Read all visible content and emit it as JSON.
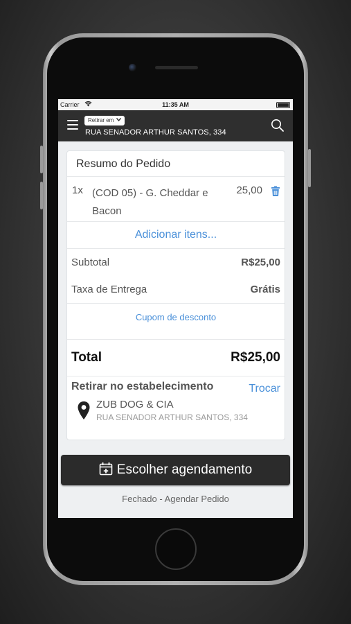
{
  "status_bar": {
    "carrier": "Carrier",
    "time": "11:35 AM"
  },
  "header": {
    "pickup_mode": "Retirar em",
    "address": "RUA SENADOR ARTHUR SANTOS, 334"
  },
  "order": {
    "title": "Resumo do Pedido",
    "items": [
      {
        "qty": "1x",
        "name": "(COD 05) - G. Cheddar e Bacon",
        "price": "25,00"
      }
    ],
    "add_items_label": "Adicionar itens...",
    "subtotal_label": "Subtotal",
    "subtotal_value": "R$25,00",
    "delivery_fee_label": "Taxa de Entrega",
    "delivery_fee_value": "Grátis",
    "coupon_label": "Cupom de desconto",
    "total_label": "Total",
    "total_value": "R$25,00"
  },
  "pickup": {
    "title": "Retirar no estabelecimento",
    "change_label": "Trocar",
    "store_name": "ZUB DOG & CIA",
    "store_address": "RUA SENADOR ARTHUR SANTOS, 334"
  },
  "schedule_button_label": "Escolher agendamento",
  "status_text": "Fechado - Agendar Pedido",
  "colors": {
    "accent": "#4a90d9",
    "header": "#2f2f2f",
    "button": "#2b2b2b"
  }
}
